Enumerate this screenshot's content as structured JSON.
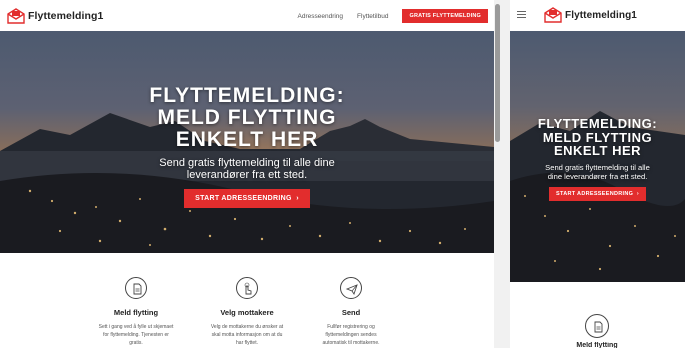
{
  "brand": {
    "name": "Flyttemelding1",
    "accent": "#e22d2d"
  },
  "nav": {
    "links": [
      "Adresseendring",
      "Flyttetilbud"
    ],
    "cta": "GRATIS FLYTTEMELDING"
  },
  "hero": {
    "title_lines": [
      "FLYTTEMELDING:",
      "MELD FLYTTING",
      "ENKELT HER"
    ],
    "subtitle_lines": [
      "Send gratis flyttemelding til alle dine",
      "leverandører fra ett sted."
    ],
    "button": "START ADRESSEENDRING",
    "button_icon": "chevron-right-icon"
  },
  "features": [
    {
      "icon": "document-icon",
      "title": "Meld flytting",
      "text_lines": [
        "Sett i gang ved å fylle ut skjemaet",
        "for flyttemelding. Tjenesten er",
        "gratis."
      ]
    },
    {
      "icon": "hand-pointer-icon",
      "title": "Velg mottakere",
      "text_lines": [
        "Velg de mottakerne du ønsker at",
        "skal motta informasjon om at du",
        "har flyttet."
      ]
    },
    {
      "icon": "send-icon",
      "title": "Send",
      "text_lines": [
        "Fullfør registrering og",
        "flyttemeldingen sendes",
        "automatisk til mottakerne."
      ]
    }
  ],
  "mobile": {
    "subtitle_lines": [
      "Send gratis flyttemelding til alle",
      "dine leverandører fra ett sted."
    ],
    "feature_title_partial": "Meld flytting"
  }
}
